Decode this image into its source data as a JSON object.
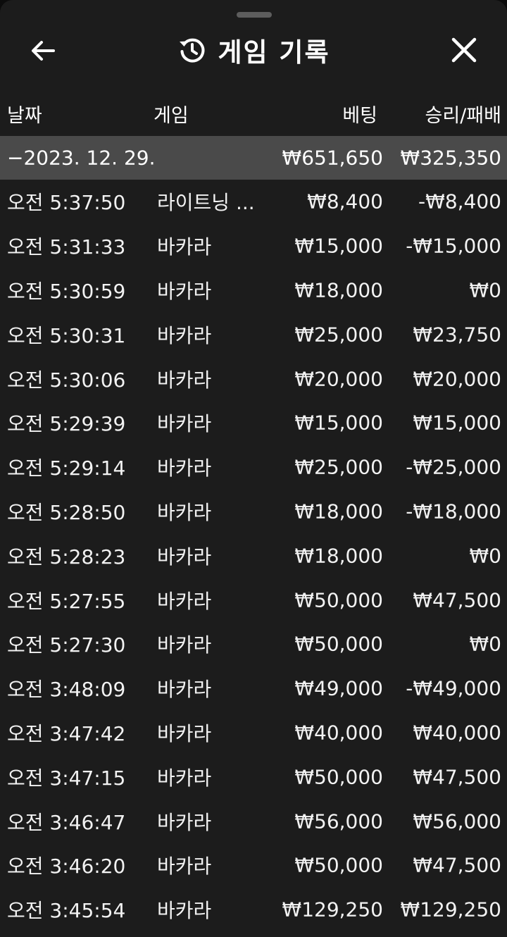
{
  "header": {
    "title": "게임 기록",
    "back_icon": "arrow-left-icon",
    "history_icon": "history-clock-icon",
    "close_icon": "close-icon"
  },
  "columns": {
    "date": "날짜",
    "game": "게임",
    "bet": "베팅",
    "win_loss": "승리/패배"
  },
  "summary": {
    "date": "−2023. 12. 29.",
    "bet": "₩651,650",
    "win_loss": "₩325,350"
  },
  "rows": [
    {
      "time": "오전 5:37:50",
      "game": "라이트닝 ...",
      "bet": "₩8,400",
      "win_loss": "-₩8,400"
    },
    {
      "time": "오전 5:31:33",
      "game": "바카라",
      "bet": "₩15,000",
      "win_loss": "-₩15,000"
    },
    {
      "time": "오전 5:30:59",
      "game": "바카라",
      "bet": "₩18,000",
      "win_loss": "₩0"
    },
    {
      "time": "오전 5:30:31",
      "game": "바카라",
      "bet": "₩25,000",
      "win_loss": "₩23,750"
    },
    {
      "time": "오전 5:30:06",
      "game": "바카라",
      "bet": "₩20,000",
      "win_loss": "₩20,000"
    },
    {
      "time": "오전 5:29:39",
      "game": "바카라",
      "bet": "₩15,000",
      "win_loss": "₩15,000"
    },
    {
      "time": "오전 5:29:14",
      "game": "바카라",
      "bet": "₩25,000",
      "win_loss": "-₩25,000"
    },
    {
      "time": "오전 5:28:50",
      "game": "바카라",
      "bet": "₩18,000",
      "win_loss": "-₩18,000"
    },
    {
      "time": "오전 5:28:23",
      "game": "바카라",
      "bet": "₩18,000",
      "win_loss": "₩0"
    },
    {
      "time": "오전 5:27:55",
      "game": "바카라",
      "bet": "₩50,000",
      "win_loss": "₩47,500"
    },
    {
      "time": "오전 5:27:30",
      "game": "바카라",
      "bet": "₩50,000",
      "win_loss": "₩0"
    },
    {
      "time": "오전 3:48:09",
      "game": "바카라",
      "bet": "₩49,000",
      "win_loss": "-₩49,000"
    },
    {
      "time": "오전 3:47:42",
      "game": "바카라",
      "bet": "₩40,000",
      "win_loss": "₩40,000"
    },
    {
      "time": "오전 3:47:15",
      "game": "바카라",
      "bet": "₩50,000",
      "win_loss": "₩47,500"
    },
    {
      "time": "오전 3:46:47",
      "game": "바카라",
      "bet": "₩56,000",
      "win_loss": "₩56,000"
    },
    {
      "time": "오전 3:46:20",
      "game": "바카라",
      "bet": "₩50,000",
      "win_loss": "₩47,500"
    },
    {
      "time": "오전 3:45:54",
      "game": "바카라",
      "bet": "₩129,250",
      "win_loss": "₩129,250"
    }
  ]
}
